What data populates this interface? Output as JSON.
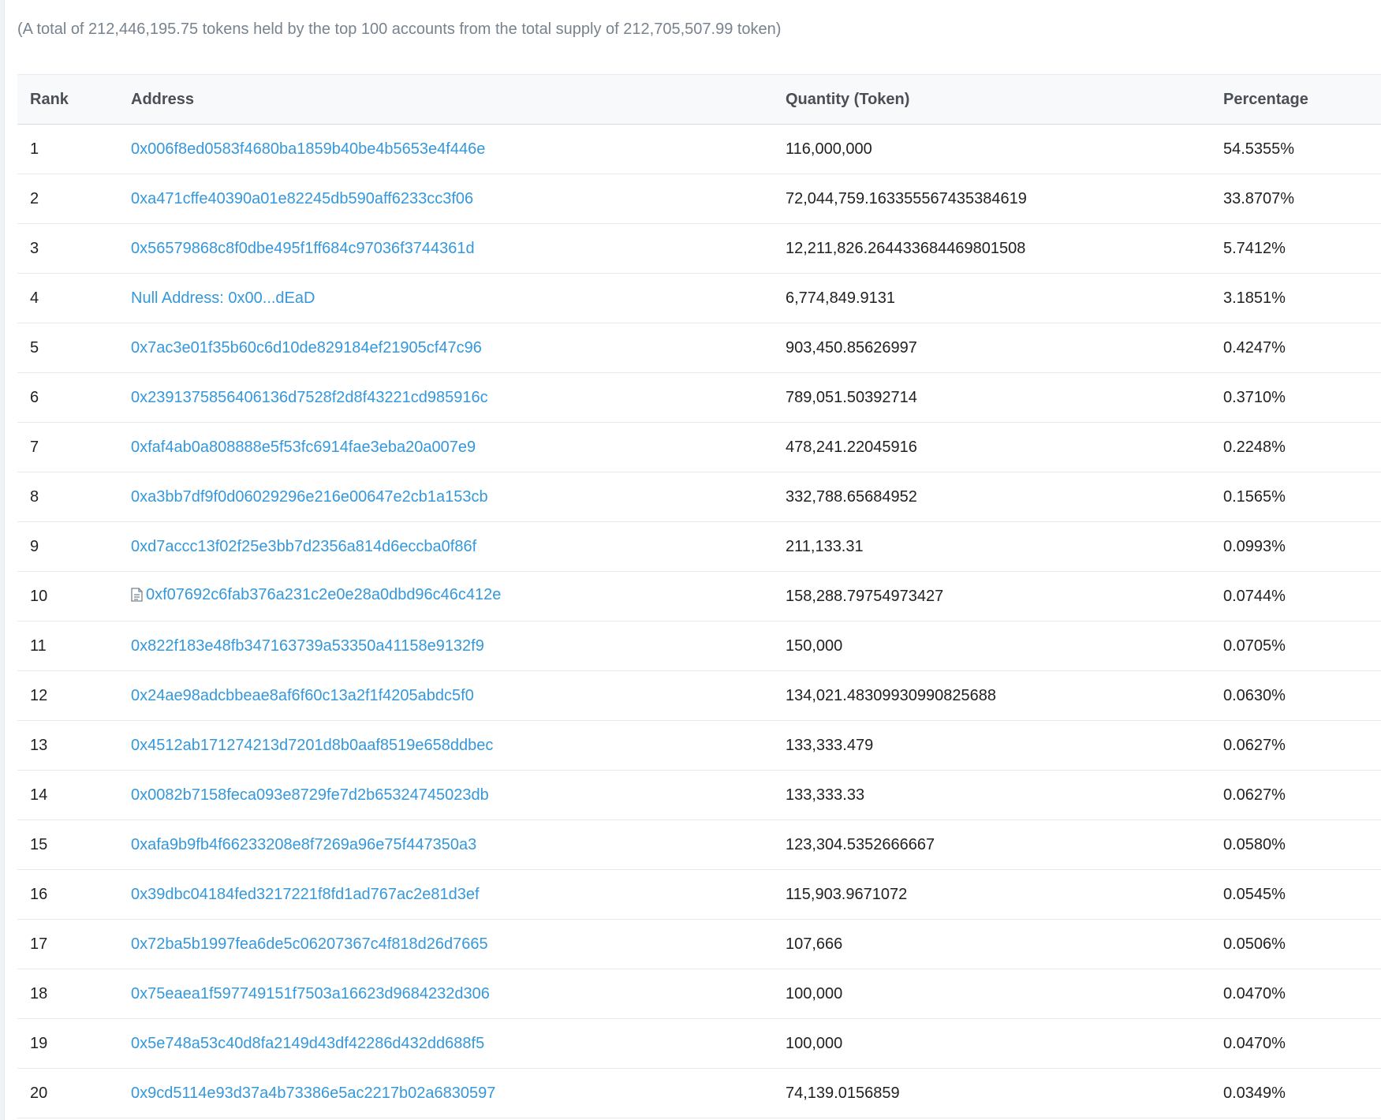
{
  "summary": "(A total of 212,446,195.75 tokens held by the top 100 accounts from the total supply of 212,705,507.99 token)",
  "table": {
    "headers": {
      "rank": "Rank",
      "address": "Address",
      "quantity": "Quantity (Token)",
      "percentage": "Percentage"
    },
    "rows": [
      {
        "rank": "1",
        "address": "0x006f8ed0583f4680ba1859b40be4b5653e4f446e",
        "quantity": "116,000,000",
        "percentage": "54.5355%"
      },
      {
        "rank": "2",
        "address": "0xa471cffe40390a01e82245db590aff6233cc3f06",
        "quantity": "72,044,759.163355567435384619",
        "percentage": "33.8707%"
      },
      {
        "rank": "3",
        "address": "0x56579868c8f0dbe495f1ff684c97036f3744361d",
        "quantity": "12,211,826.264433684469801508",
        "percentage": "5.7412%"
      },
      {
        "rank": "4",
        "address": "Null Address: 0x00...dEaD",
        "quantity": "6,774,849.9131",
        "percentage": "3.1851%"
      },
      {
        "rank": "5",
        "address": "0x7ac3e01f35b60c6d10de829184ef21905cf47c96",
        "quantity": "903,450.85626997",
        "percentage": "0.4247%"
      },
      {
        "rank": "6",
        "address": "0x2391375856406136d7528f2d8f43221cd985916c",
        "quantity": "789,051.50392714",
        "percentage": "0.3710%"
      },
      {
        "rank": "7",
        "address": "0xfaf4ab0a808888e5f53fc6914fae3eba20a007e9",
        "quantity": "478,241.22045916",
        "percentage": "0.2248%"
      },
      {
        "rank": "8",
        "address": "0xa3bb7df9f0d06029296e216e00647e2cb1a153cb",
        "quantity": "332,788.65684952",
        "percentage": "0.1565%"
      },
      {
        "rank": "9",
        "address": "0xd7accc13f02f25e3bb7d2356a814d6eccba0f86f",
        "quantity": "211,133.31",
        "percentage": "0.0993%"
      },
      {
        "rank": "10",
        "address": "0xf07692c6fab376a231c2e0e28a0dbd96c46c412e",
        "quantity": "158,288.79754973427",
        "percentage": "0.0744%",
        "contract": true
      },
      {
        "rank": "11",
        "address": "0x822f183e48fb347163739a53350a41158e9132f9",
        "quantity": "150,000",
        "percentage": "0.0705%"
      },
      {
        "rank": "12",
        "address": "0x24ae98adcbbeae8af6f60c13a2f1f4205abdc5f0",
        "quantity": "134,021.48309930990825688",
        "percentage": "0.0630%"
      },
      {
        "rank": "13",
        "address": "0x4512ab171274213d7201d8b0aaf8519e658ddbec",
        "quantity": "133,333.479",
        "percentage": "0.0627%"
      },
      {
        "rank": "14",
        "address": "0x0082b7158feca093e8729fe7d2b65324745023db",
        "quantity": "133,333.33",
        "percentage": "0.0627%"
      },
      {
        "rank": "15",
        "address": "0xafa9b9fb4f66233208e8f7269a96e75f447350a3",
        "quantity": "123,304.5352666667",
        "percentage": "0.0580%"
      },
      {
        "rank": "16",
        "address": "0x39dbc04184fed3217221f8fd1ad767ac2e81d3ef",
        "quantity": "115,903.9671072",
        "percentage": "0.0545%"
      },
      {
        "rank": "17",
        "address": "0x72ba5b1997fea6de5c06207367c4f818d26d7665",
        "quantity": "107,666",
        "percentage": "0.0506%"
      },
      {
        "rank": "18",
        "address": "0x75eaea1f597749151f7503a16623d9684232d306",
        "quantity": "100,000",
        "percentage": "0.0470%"
      },
      {
        "rank": "19",
        "address": "0x5e748a53c40d8fa2149d43df42286d432dd688f5",
        "quantity": "100,000",
        "percentage": "0.0470%"
      },
      {
        "rank": "20",
        "address": "0x9cd5114e93d37a4b73386e5ac2217b02a6830597",
        "quantity": "74,139.0156859",
        "percentage": "0.0349%"
      }
    ]
  },
  "icons": {
    "contract": "contract-file-icon"
  },
  "colors": {
    "link": "#3498db",
    "muted_text": "#77838f",
    "header_bg": "#f8f9fa",
    "row_border": "#e7eaf3"
  }
}
